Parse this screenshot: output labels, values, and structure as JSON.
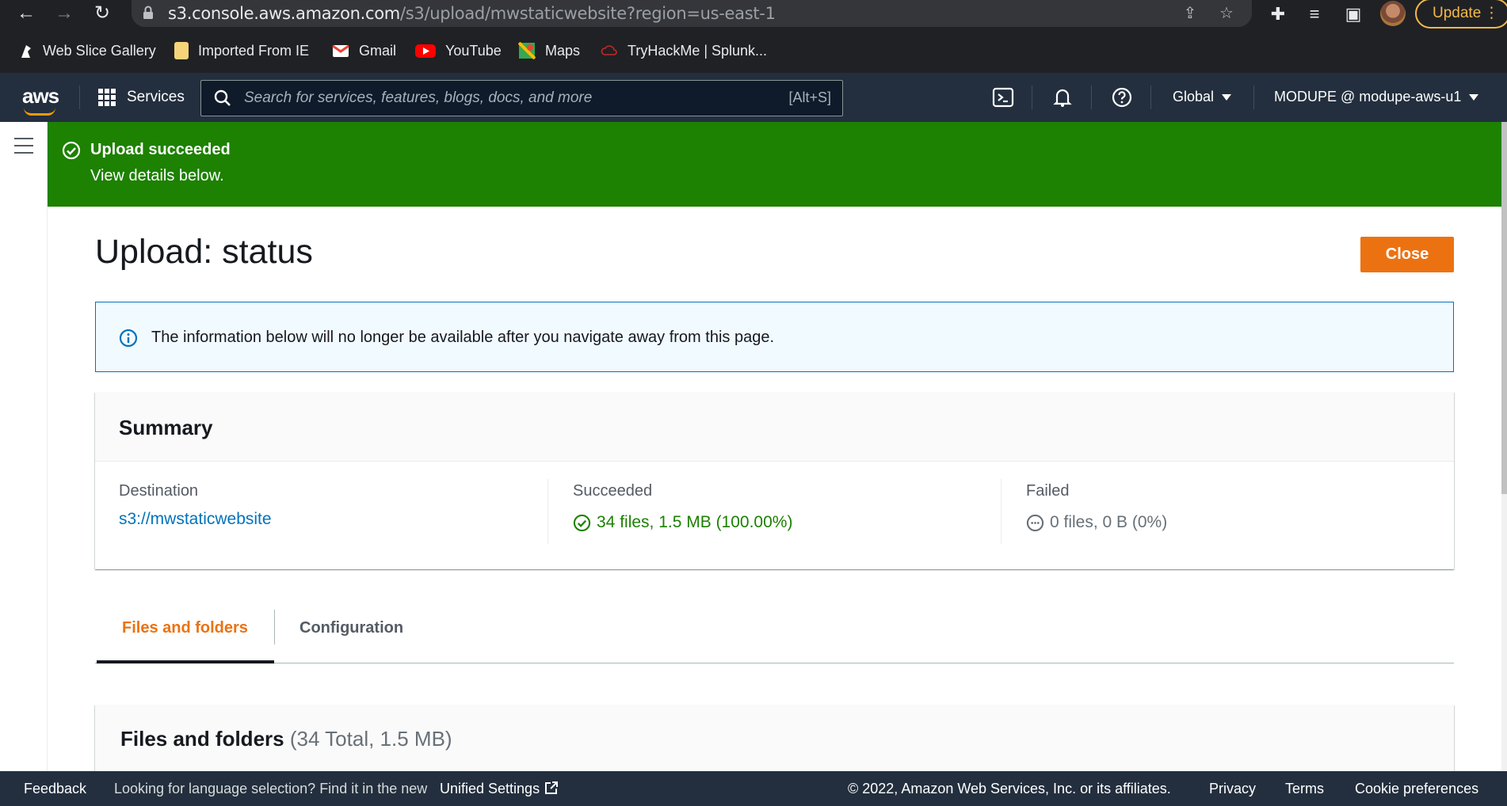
{
  "browser": {
    "url_host": "s3.console.aws.amazon.com",
    "url_path": "/s3/upload/mwstaticwebsite?region=us-east-1",
    "update_label": "Update",
    "bookmarks": [
      {
        "label": "Web Slice Gallery",
        "icon": "web-slice-icon",
        "color": "#ffffff"
      },
      {
        "label": "Imported From IE",
        "icon": "folder-icon",
        "color": "#f6d47a"
      },
      {
        "label": "Gmail",
        "icon": "gmail-icon",
        "color": "#ea4335"
      },
      {
        "label": "YouTube",
        "icon": "youtube-icon",
        "color": "#ff0000"
      },
      {
        "label": "Maps",
        "icon": "maps-icon",
        "color": "#34a853"
      },
      {
        "label": "TryHackMe | Splunk...",
        "icon": "cloud-icon",
        "color": "#c62828"
      }
    ]
  },
  "aws_header": {
    "logo": "aws",
    "services_label": "Services",
    "search_placeholder": "Search for services, features, blogs, docs, and more",
    "search_shortcut": "[Alt+S]",
    "region": "Global",
    "account": "MODUPE @ modupe-aws-u1"
  },
  "flash": {
    "title": "Upload succeeded",
    "subtitle": "View details below."
  },
  "page": {
    "title": "Upload: status",
    "close_label": "Close",
    "info_message": "The information below will no longer be available after you navigate away from this page."
  },
  "summary": {
    "title": "Summary",
    "destination_label": "Destination",
    "destination_value": "s3://mwstaticwebsite",
    "succeeded_label": "Succeeded",
    "succeeded_value": "34 files, 1.5 MB (100.00%)",
    "failed_label": "Failed",
    "failed_value": "0 files, 0 B (0%)"
  },
  "tabs": [
    {
      "label": "Files and folders",
      "active": true
    },
    {
      "label": "Configuration",
      "active": false
    }
  ],
  "files_panel": {
    "title": "Files and folders",
    "count": "(34 Total, 1.5 MB)"
  },
  "footer": {
    "feedback": "Feedback",
    "language_prompt": "Looking for language selection? Find it in the new",
    "unified_settings": "Unified Settings",
    "copyright": "© 2022, Amazon Web Services, Inc. or its affiliates.",
    "privacy": "Privacy",
    "terms": "Terms",
    "cookie": "Cookie preferences"
  },
  "colors": {
    "aws_nav": "#232f3e",
    "success": "#1d8102",
    "accent": "#ec7211",
    "link": "#0073bb"
  }
}
